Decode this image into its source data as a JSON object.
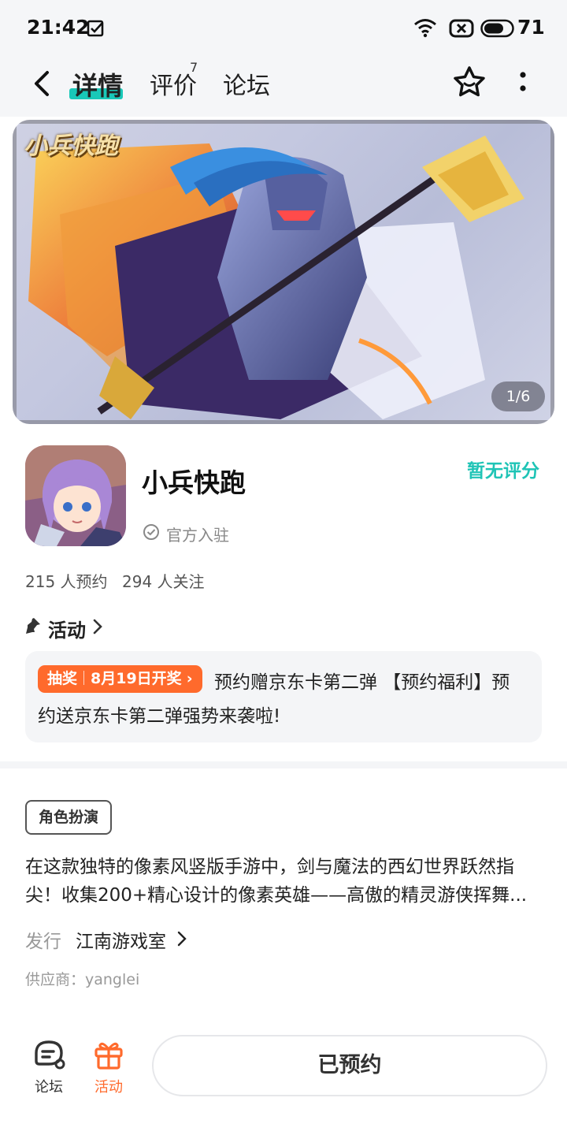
{
  "status_bar": {
    "time": "21:42",
    "battery": "71"
  },
  "header": {
    "tabs": [
      {
        "label": "详情",
        "active": true
      },
      {
        "label": "评价",
        "badge": "7"
      },
      {
        "label": "论坛"
      }
    ]
  },
  "banner": {
    "logo_text": "小兵快跑",
    "counter": "1/6"
  },
  "app": {
    "name": "小兵快跑",
    "rating": "暂无评分",
    "verified": "官方入驻",
    "reservations": "215 人预约",
    "followers": "294 人关注"
  },
  "activity": {
    "title": "活动",
    "tag_left": "抽奖",
    "tag_right": "8月19日开奖",
    "text_line1": "预约赠京东卡第二弹 【预约福利】预",
    "text_line2": "约送京东卡第二弹强势来袭啦!"
  },
  "details": {
    "genre": "角色扮演",
    "description_line1": "在这款独特的像素风竖版手游中，剑与魔法的西幻世界跃然指",
    "description_line2": "尖！收集200+精心设计的像素英雄——高傲的精灵游侠挥舞...",
    "publisher_label": "发行",
    "publisher": "江南游戏室",
    "supplier": "供应商：yanglei"
  },
  "bottom_bar": {
    "forum_label": "论坛",
    "activity_label": "活动",
    "reserve_button": "已预约"
  },
  "colors": {
    "accent": "#19c8b8",
    "orange": "#ff6a2c"
  }
}
